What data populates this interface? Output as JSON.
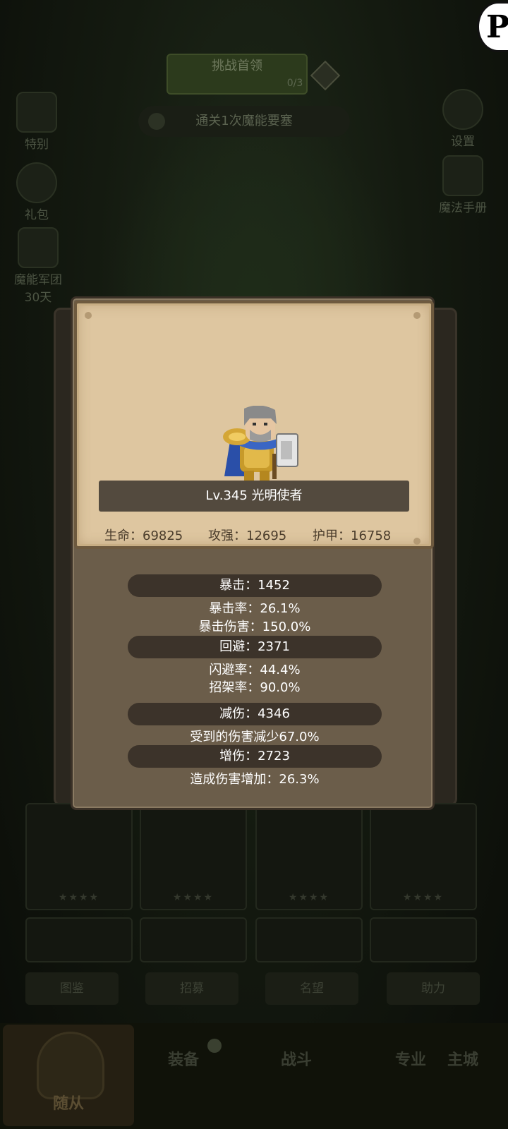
{
  "background": {
    "top_button": {
      "label": "挑战首领",
      "sub": "0/3"
    },
    "quest_text": "通关1次魔能要塞",
    "left_icons": [
      {
        "label": "特别"
      },
      {
        "label": "礼包"
      },
      {
        "label": "魔能军团",
        "sub": "30天"
      }
    ],
    "right_icons": [
      {
        "label": "设置"
      },
      {
        "label": "魔法手册"
      }
    ],
    "tabs": [
      "图鉴",
      "招募",
      "名望",
      "助力"
    ],
    "nav": {
      "selected": "随从",
      "items": [
        "装备",
        "战斗",
        "专业",
        "主城"
      ]
    }
  },
  "hero": {
    "name_line": "Lv.345 光明使者",
    "stats": {
      "hp": "生命：69825",
      "atk": "攻强：12695",
      "armor": "护甲：16758"
    }
  },
  "details": {
    "crit_title": "暴击：1452",
    "crit_rate": "暴击率：26.1%",
    "crit_dmg": "暴击伤害：150.0%",
    "dodge_title": "回避：2371",
    "dodge_rate": "闪避率：44.4%",
    "parry_rate": "招架率：90.0%",
    "reduce_title": "减伤：4346",
    "reduce_desc": "受到的伤害减少67.0%",
    "increase_title": "增伤：2723",
    "increase_desc": "造成伤害增加：26.3%"
  },
  "colors": {
    "parchment": "#dec6a0",
    "panel": "#6b5d4a",
    "pill": "#3c332a",
    "overlay": "#0d0f0a"
  }
}
